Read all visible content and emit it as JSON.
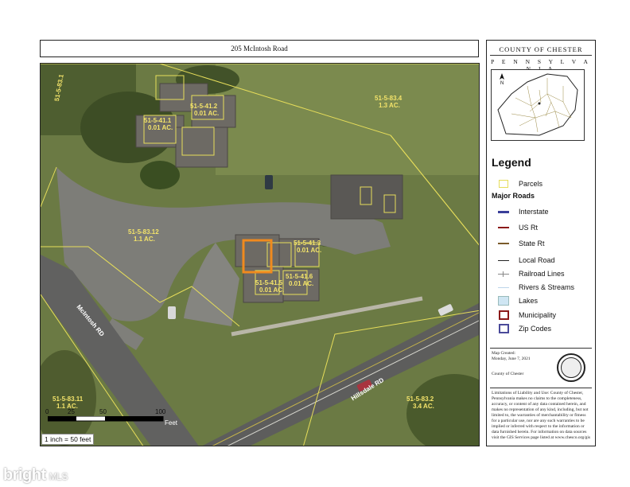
{
  "header": {
    "title": "205 McIntosh Road"
  },
  "sidebar": {
    "county": "COUNTY OF CHESTER",
    "state": "P E N N S Y L V A N I A",
    "legend_title": "Legend",
    "parcels_label": "Parcels",
    "major_roads_label": "Major Roads",
    "items": [
      {
        "label": "Interstate",
        "color": "#3a3f9a"
      },
      {
        "label": "US Rt",
        "color": "#8b1a1a"
      },
      {
        "label": "State Rt",
        "color": "#7a5a2a"
      },
      {
        "label": "Local Road",
        "color": "#222222"
      },
      {
        "label": "Railroad Lines",
        "color": "#888888"
      },
      {
        "label": "Rivers & Streams",
        "color": "#bcd4ea"
      },
      {
        "label": "Lakes",
        "color": "#cfe6f3"
      },
      {
        "label": "Municipality",
        "color": "#8b1a1a"
      },
      {
        "label": "Zip Codes",
        "color": "#4a4a9a"
      }
    ],
    "map_created": "Map Created:",
    "map_date": "Monday, June 7, 2021",
    "map_author": "County of Chester",
    "disclaimer": "Limitations of Liability and Use: County of Chester, Pennsylvania makes no claims to the completeness, accuracy, or content of any data contained herein, and makes no representation of any kind, including, but not limited to, the warranties of merchantability or fitness for a particular use, nor are any such warranties to be implied or inferred with respect to the information or data furnished herein. For information on data sources visit the GIS Services page listed at www.chesco.org/gis"
  },
  "map": {
    "parcels": [
      {
        "id": "51-5-83.4",
        "area": "1.3 AC."
      },
      {
        "id": "51-5-83.12",
        "area": "1.1 AC."
      },
      {
        "id": "51-5-83.11",
        "area": "1.1 AC."
      },
      {
        "id": "51-5-83.2",
        "area": "3.4 AC."
      },
      {
        "id": "51-5-83.1",
        "area": ""
      },
      {
        "id": "51-5-41.1",
        "area": "0.01 AC."
      },
      {
        "id": "51-5-41.2",
        "area": "0.01 AC."
      },
      {
        "id": "51-5-41.3",
        "area": "0.01 AC."
      },
      {
        "id": "51-5-41.5",
        "area": "0.01 AC."
      },
      {
        "id": "51-5-41.6",
        "area": "0.01 AC."
      }
    ],
    "roads": [
      "McIntosh RD",
      "Hillsdale RD"
    ]
  },
  "scale": {
    "ticks": [
      "0",
      "25",
      "50",
      "100"
    ],
    "unit": "Feet",
    "note": "1 inch = 50 feet"
  },
  "watermark": {
    "brand": "bright",
    "suffix": "MLS"
  }
}
